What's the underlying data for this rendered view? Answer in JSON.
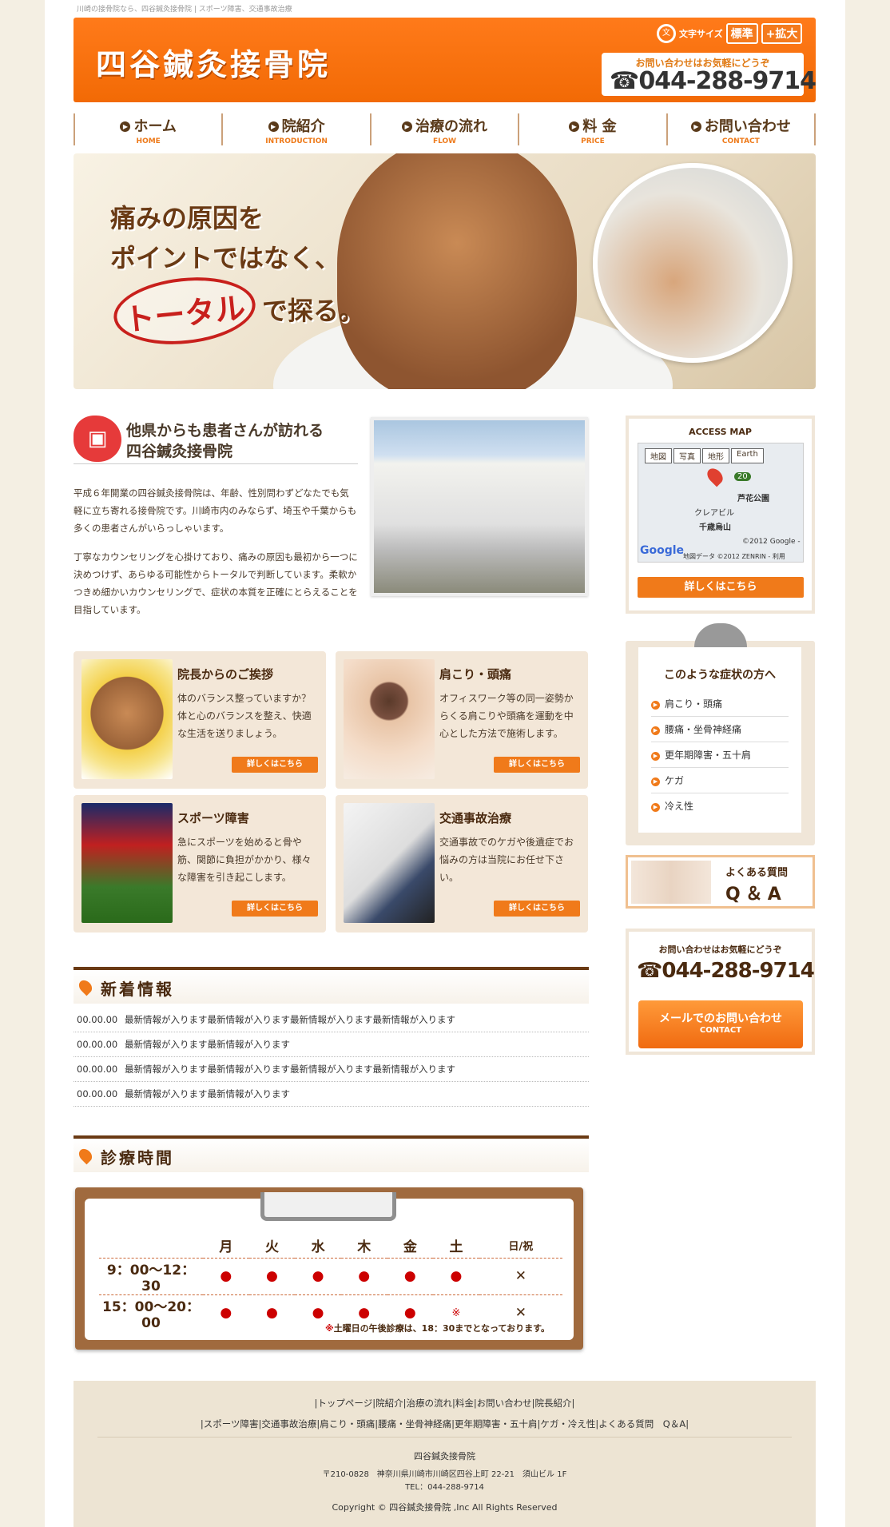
{
  "tagline": "川崎の接骨院なら、四谷鍼灸接骨院 | スポーツ障害、交通事故治療",
  "header": {
    "logo": "四谷鍼灸接骨院",
    "font_size_label": "文字サイズ",
    "font_standard": "標準",
    "font_large": "+拡大",
    "tel_note": "お問い合わせはお気軽にどうぞ",
    "tel": "☎044-288-9714"
  },
  "nav": [
    {
      "jp": "ホーム",
      "en": "HOME"
    },
    {
      "jp": "院紹介",
      "en": "INTRODUCTION"
    },
    {
      "jp": "治療の流れ",
      "en": "FLOW"
    },
    {
      "jp": "料 金",
      "en": "PRICE"
    },
    {
      "jp": "お問い合わせ",
      "en": "CONTACT"
    }
  ],
  "hero": {
    "line1": "痛みの原因を",
    "line2": "ポイントではなく、",
    "highlight": "トータル",
    "line3": "で探る。"
  },
  "intro": {
    "title1": "他県からも患者さんが訪れる",
    "title2": "四谷鍼灸接骨院",
    "p1": "平成６年開業の四谷鍼灸接骨院は、年齢、性別問わずどなたでも気軽に立ち寄れる接骨院です。川崎市内のみならず、埼玉や千葉からも多くの患者さんがいらっしゃいます。",
    "p2": "丁寧なカウンセリングを心掛けており、痛みの原因も最初から一つに決めつけず、あらゆる可能性からトータルで判断しています。柔軟かつきめ細かいカウンセリングで、症状の本質を正確にとらえることを目指しています。"
  },
  "cards": [
    {
      "title": "院長からのご挨拶",
      "text": "体のバランス整っていますか？体と心のバランスを整え、快適な生活を送りましょう。",
      "button": "詳しくはこちら"
    },
    {
      "title": "肩こり・頭痛",
      "text": "オフィスワーク等の同一姿勢からくる肩こりや頭痛を運動を中心とした方法で施術します。",
      "button": "詳しくはこちら"
    },
    {
      "title": "スポーツ障害",
      "text": "急にスポーツを始めると骨や筋、関節に負担がかかり、様々な障害を引き起こします。",
      "button": "詳しくはこちら"
    },
    {
      "title": "交通事故治療",
      "text": "交通事故でのケガや後遺症でお悩みの方は当院にお任せ下さい。",
      "button": "詳しくはこちら"
    }
  ],
  "news": {
    "title": "新着情報",
    "items": [
      {
        "date": "00.00.00",
        "text": "最新情報が入ります最新情報が入ります最新情報が入ります最新情報が入ります"
      },
      {
        "date": "00.00.00",
        "text": "最新情報が入ります最新情報が入ります"
      },
      {
        "date": "00.00.00",
        "text": "最新情報が入ります最新情報が入ります最新情報が入ります最新情報が入ります"
      },
      {
        "date": "00.00.00",
        "text": "最新情報が入ります最新情報が入ります"
      }
    ]
  },
  "hours": {
    "title": "診療時間",
    "days": [
      "月",
      "火",
      "水",
      "木",
      "金",
      "土",
      "日/祝"
    ],
    "rows": [
      {
        "time": "9：00～12：30",
        "marks": [
          "●",
          "●",
          "●",
          "●",
          "●",
          "●",
          "✕"
        ]
      },
      {
        "time": "15：00～20：00",
        "marks": [
          "●",
          "●",
          "●",
          "●",
          "●",
          "※",
          "✕"
        ]
      }
    ],
    "note_mark": "※",
    "note": "土曜日の午後診療は、18：30までとなっております。"
  },
  "sidebar": {
    "map_title": "ACCESS MAP",
    "map_tabs": [
      "地図",
      "写真",
      "地形",
      "Earth"
    ],
    "map_labels": {
      "park": "芦花公園",
      "station": "千歳烏山",
      "bldg": "クレアビル",
      "copyright": "©2012 Google -",
      "data": "地図データ ©2012 ZENRIN - 利用",
      "google": "Google",
      "route": "20"
    },
    "map_button": "詳しくはこちら",
    "symptom_title": "このような症状の方へ",
    "symptoms": [
      "肩こり・頭痛",
      "腰痛・坐骨神経痛",
      "更年期障害・五十肩",
      "ケガ",
      "冷え性"
    ],
    "faq_line1": "よくある質問",
    "faq_line2": "Q＆A",
    "contact_note": "お問い合わせはお気軽にどうぞ",
    "contact_tel": "☎044-288-9714",
    "contact_btn1": "メールでのお問い合わせ",
    "contact_btn2": "CONTACT"
  },
  "footer": {
    "links1": "|トップページ|院紹介|治療の流れ|料金|お問い合わせ|院長紹介|",
    "links2": "|スポーツ障害|交通事故治療|肩こり・頭痛|腰痛・坐骨神経痛|更年期障害・五十肩|ケガ・冷え性|よくある質問　Q＆A|",
    "name": "四谷鍼灸接骨院",
    "address": "〒210-0828　神奈川県川崎市川崎区四谷上町 22-21　須山ビル 1F",
    "tel": "TEL：044-288-9714",
    "copyright": "Copyright © 四谷鍼灸接骨院 ,Inc All Rights Reserved"
  },
  "colors": {
    "accent": "#f07a1a",
    "brown": "#4a2a10",
    "red": "#c00000"
  }
}
